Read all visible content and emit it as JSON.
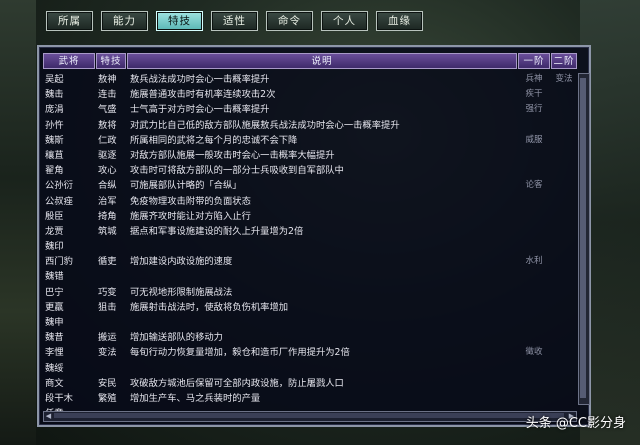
{
  "tabs": [
    "所属",
    "能力",
    "特技",
    "适性",
    "命令",
    "个人",
    "血缘"
  ],
  "active_tab": 2,
  "headers": [
    "武将",
    "特技",
    "说明",
    "一阶",
    "二阶"
  ],
  "rows": [
    {
      "name": "吴起",
      "skill": "敖神",
      "desc": "敖兵战法成功时会心一击概率提升",
      "tier1": "兵神",
      "tier2": "变法"
    },
    {
      "name": "魏击",
      "skill": "连击",
      "desc": "施展普通攻击时有机率连续攻击2次",
      "tier1": "疾干",
      "tier2": ""
    },
    {
      "name": "庞涓",
      "skill": "气盛",
      "desc": "士气高于对方时会心一击概率提升",
      "tier1": "强行",
      "tier2": ""
    },
    {
      "name": "孙忤",
      "skill": "敖将",
      "desc": "对武力比自己低的敌方部队施展敖兵战法成功时会心一击概率提升",
      "tier1": "",
      "tier2": ""
    },
    {
      "name": "魏斯",
      "skill": "仁政",
      "desc": "所属相同的武将之每个月的忠诚不会下降",
      "tier1": "威服",
      "tier2": ""
    },
    {
      "name": "穰苴",
      "skill": "驱逐",
      "desc": "对敌方部队施展一般攻击时会心一击概率大幅提升",
      "tier1": "",
      "tier2": ""
    },
    {
      "name": "翟角",
      "skill": "攻心",
      "desc": "攻击时可将敌方部队的一部分士兵吸收到自军部队中",
      "tier1": "",
      "tier2": ""
    },
    {
      "name": "公孙衍",
      "skill": "合纵",
      "desc": "可施展部队计略的「合纵」",
      "tier1": "论客",
      "tier2": ""
    },
    {
      "name": "公叔痤",
      "skill": "治军",
      "desc": "免疫物理攻击附带的负面状态",
      "tier1": "",
      "tier2": ""
    },
    {
      "name": "殷臣",
      "skill": "掎角",
      "desc": "施展齐攻时能让对方陷入止行",
      "tier1": "",
      "tier2": ""
    },
    {
      "name": "龙贾",
      "skill": "筑城",
      "desc": "据点和军事设施建设的耐久上升量增为2倍",
      "tier1": "",
      "tier2": ""
    },
    {
      "name": "魏印",
      "skill": "",
      "desc": "",
      "tier1": "",
      "tier2": ""
    },
    {
      "name": "西门豹",
      "skill": "循吏",
      "desc": "增加建设内政设施的速度",
      "tier1": "水利",
      "tier2": ""
    },
    {
      "name": "魏错",
      "skill": "",
      "desc": "",
      "tier1": "",
      "tier2": ""
    },
    {
      "name": "巴宁",
      "skill": "巧变",
      "desc": "可无视地形限制施展战法",
      "tier1": "",
      "tier2": ""
    },
    {
      "name": "更羸",
      "skill": "狙击",
      "desc": "施展射击战法时，使敌将负伤机率增加",
      "tier1": "",
      "tier2": ""
    },
    {
      "name": "魏申",
      "skill": "",
      "desc": "",
      "tier1": "",
      "tier2": ""
    },
    {
      "name": "魏昔",
      "skill": "搬运",
      "desc": "增加输送部队的移动力",
      "tier1": "",
      "tier2": ""
    },
    {
      "name": "李悝",
      "skill": "变法",
      "desc": "每旬行动力恢复量增加，毅仓和造币厂作用提升为2倍",
      "tier1": "徵收",
      "tier2": ""
    },
    {
      "name": "魏绥",
      "skill": "",
      "desc": "",
      "tier1": "",
      "tier2": ""
    },
    {
      "name": "商文",
      "skill": "安民",
      "desc": "攻破敌方城池后保留可全部内政设施，防止屠戮人口",
      "tier1": "",
      "tier2": ""
    },
    {
      "name": "段干木",
      "skill": "繁殖",
      "desc": "增加生产车、马之兵装时的产量",
      "tier1": "",
      "tier2": ""
    },
    {
      "name": "任章",
      "skill": "",
      "desc": "",
      "tier1": "",
      "tier2": ""
    }
  ],
  "watermark": "头条 @CC影分身"
}
